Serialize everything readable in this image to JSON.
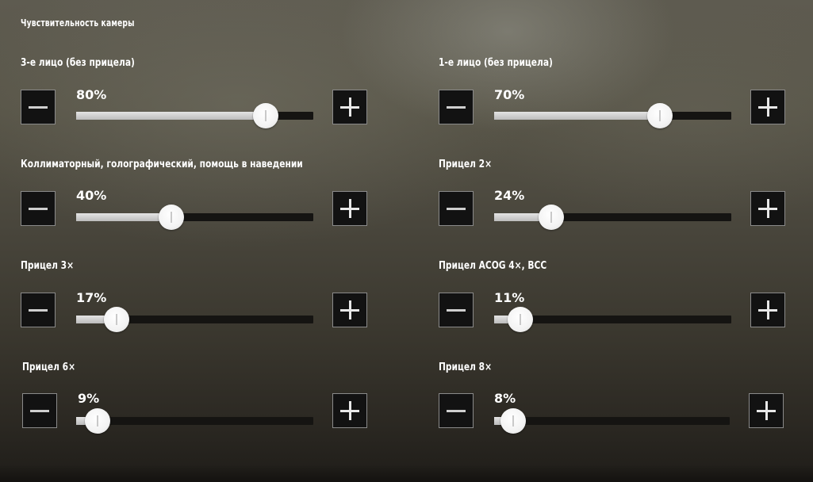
{
  "section_title": "Чувствительность камеры",
  "settings": [
    {
      "label": "3-е лицо (без прицела)",
      "value": 80,
      "value_text": "80%"
    },
    {
      "label": "1-е лицо (без прицела)",
      "value": 70,
      "value_text": "70%"
    },
    {
      "label": "Коллиматорный, голографический, помощь в наведении",
      "value": 40,
      "value_text": "40%"
    },
    {
      "label": "Прицел 2×",
      "value": 24,
      "value_text": "24%"
    },
    {
      "label": "Прицел 3×",
      "value": 17,
      "value_text": "17%"
    },
    {
      "label": "Прицел ACOG 4×, ВСС",
      "value": 11,
      "value_text": "11%"
    },
    {
      "label": "Прицел 6×",
      "value": 9,
      "value_text": "9%"
    },
    {
      "label": "Прицел 8×",
      "value": 8,
      "value_text": "8%"
    }
  ],
  "icons": {
    "decrease": "minus-icon",
    "increase": "plus-icon"
  },
  "colors": {
    "track": "#151412",
    "fill": "#d2d2d2",
    "thumb": "#f3f3f3",
    "button_bg": "#121212",
    "button_border": "#8a8a8a"
  }
}
